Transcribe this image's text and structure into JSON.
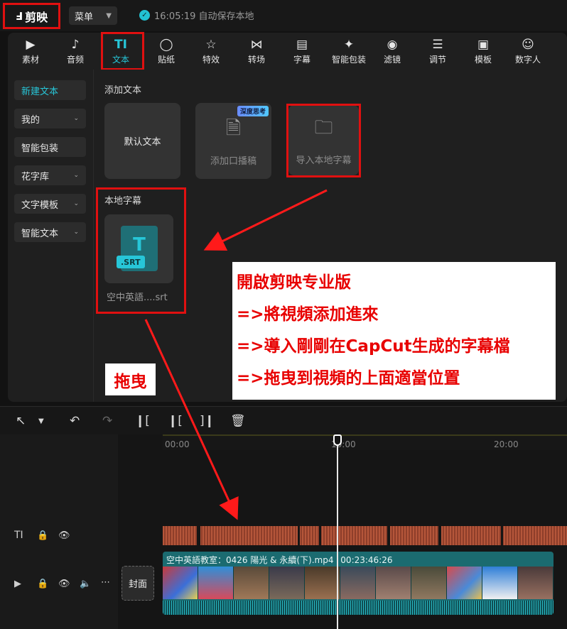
{
  "app": {
    "logo": "剪映",
    "menu_label": "菜单",
    "save_status": "16:05:19 自动保存本地"
  },
  "tabs": [
    {
      "label": "素材",
      "icon": "media-icon"
    },
    {
      "label": "音频",
      "icon": "audio-icon"
    },
    {
      "label": "文本",
      "icon": "text-icon",
      "glyph": "TI"
    },
    {
      "label": "贴纸",
      "icon": "sticker-icon"
    },
    {
      "label": "特效",
      "icon": "effects-icon"
    },
    {
      "label": "转场",
      "icon": "transition-icon"
    },
    {
      "label": "字幕",
      "icon": "caption-icon"
    },
    {
      "label": "智能包装",
      "icon": "smart-pack-icon"
    },
    {
      "label": "滤镜",
      "icon": "filter-icon"
    },
    {
      "label": "调节",
      "icon": "adjust-icon"
    },
    {
      "label": "模板",
      "icon": "template-icon"
    },
    {
      "label": "数字人",
      "icon": "avatar-icon"
    }
  ],
  "sidebar": [
    {
      "label": "新建文本"
    },
    {
      "label": "我的"
    },
    {
      "label": "智能包装"
    },
    {
      "label": "花字库"
    },
    {
      "label": "文字模板"
    },
    {
      "label": "智能文本"
    }
  ],
  "add_text": {
    "title": "添加文本",
    "default_text": "默认文本",
    "voice_text": "添加口播稿",
    "badge": "深度思考",
    "import_local": "导入本地字幕"
  },
  "local_subtitles": {
    "title": "本地字幕",
    "file_tag": ".SRT",
    "file_name": "空中英語....srt"
  },
  "annotation": {
    "lines": [
      "開啟剪映专业版",
      "=>將視頻添加進來",
      "=>導入剛剛在CapCut生成的字幕檔",
      "=>拖曳到視頻的上面適當位置"
    ],
    "drag": "拖曳"
  },
  "timeline": {
    "ruler": [
      "00:00",
      "10:00",
      "20:00"
    ],
    "video_title": "空中英語教室：0426 陽光 & 永續(下).mp4",
    "video_duration": "00:23:46:26",
    "cover_label": "封面",
    "text_track_icon": "TI"
  },
  "colors": {
    "accent": "#27c6d8",
    "highlight": "#e01010",
    "text_clip": "#b5563a",
    "video_clip": "#1b6b70"
  }
}
